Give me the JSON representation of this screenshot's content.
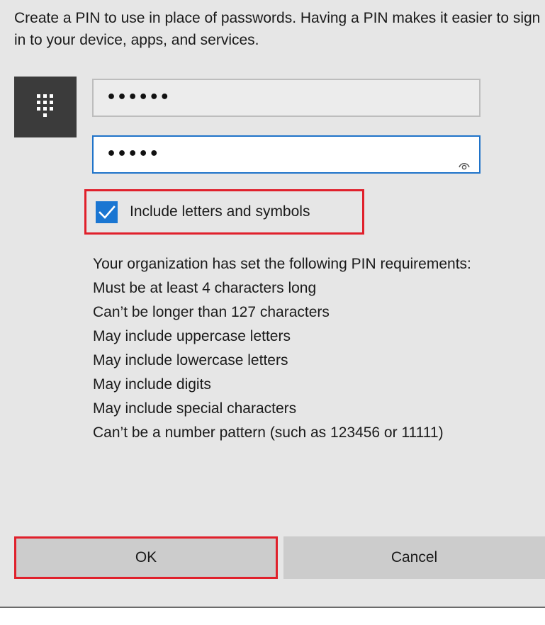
{
  "dialog": {
    "intro_text": "Create a PIN to use in place of passwords. Having a PIN makes it easier to sign in to your device, apps, and services.",
    "icon": "keypad-icon",
    "new_pin": {
      "masked_value": "••••••"
    },
    "confirm_pin": {
      "masked_value": "•••••",
      "reveal_icon": "eye-icon"
    },
    "include_letters_checkbox": {
      "label": "Include letters and symbols",
      "checked": true
    },
    "requirements": [
      "Your organization has set the following PIN requirements:",
      "Must be at least 4 characters long",
      "Can’t be longer than 127 characters",
      "May include uppercase letters",
      "May include lowercase letters",
      "May include digits",
      "May include special characters",
      "Can’t be a number pattern (such as 123456 or 11111)"
    ],
    "buttons": {
      "ok_label": "OK",
      "cancel_label": "Cancel"
    }
  },
  "colors": {
    "dialog_background": "#e6e6e6",
    "accent_blue": "#1a76d2",
    "highlight_red": "#e0202b",
    "button_gray": "#cccccc",
    "icon_tile": "#3b3b3b"
  }
}
